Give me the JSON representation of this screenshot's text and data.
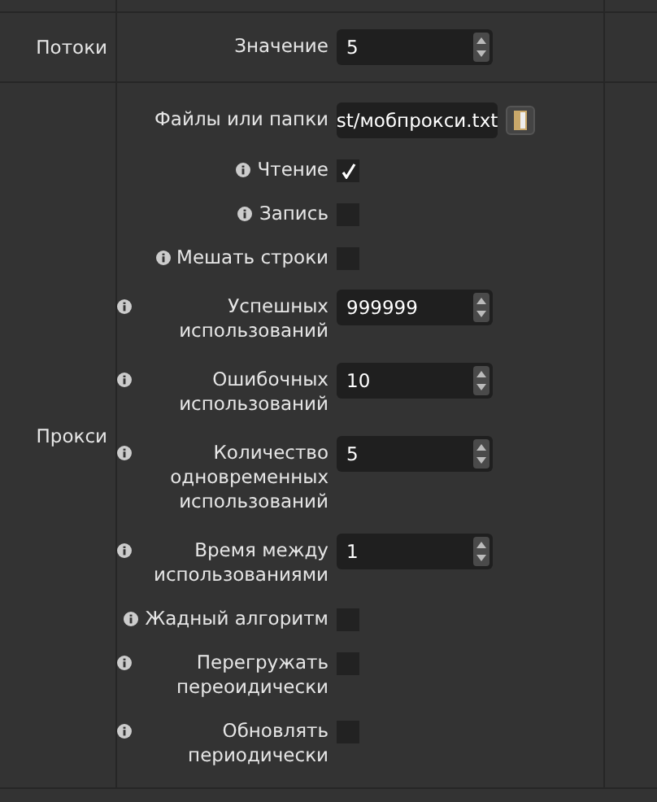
{
  "sections": [
    {
      "title": "Потоки",
      "items": [
        {
          "kind": "spin",
          "label": "Значение",
          "info": false,
          "value": "5"
        }
      ]
    },
    {
      "title": "Прокси",
      "items": [
        {
          "kind": "file",
          "label": "Файлы или папки",
          "info": false,
          "value": "st/мобпрокси.txt"
        },
        {
          "kind": "check",
          "label": "Чтение",
          "info": true,
          "checked": true
        },
        {
          "kind": "check",
          "label": "Запись",
          "info": true,
          "checked": false
        },
        {
          "kind": "check",
          "label": "Мешать строки",
          "info": true,
          "checked": false
        },
        {
          "kind": "spin",
          "label": "Успешных использований",
          "info": true,
          "value": "999999"
        },
        {
          "kind": "spin",
          "label": "Ошибочных использований",
          "info": true,
          "value": "10"
        },
        {
          "kind": "spin",
          "label": "Количество одновременных использований",
          "info": true,
          "value": "5"
        },
        {
          "kind": "spin",
          "label": "Время между использованиями",
          "info": true,
          "value": "1"
        },
        {
          "kind": "check",
          "label": "Жадный алгоритм",
          "info": true,
          "checked": false
        },
        {
          "kind": "check",
          "label": "Перегружать переоидически",
          "info": true,
          "checked": false
        },
        {
          "kind": "check",
          "label": "Обновлять периодически",
          "info": true,
          "checked": false
        }
      ]
    }
  ]
}
